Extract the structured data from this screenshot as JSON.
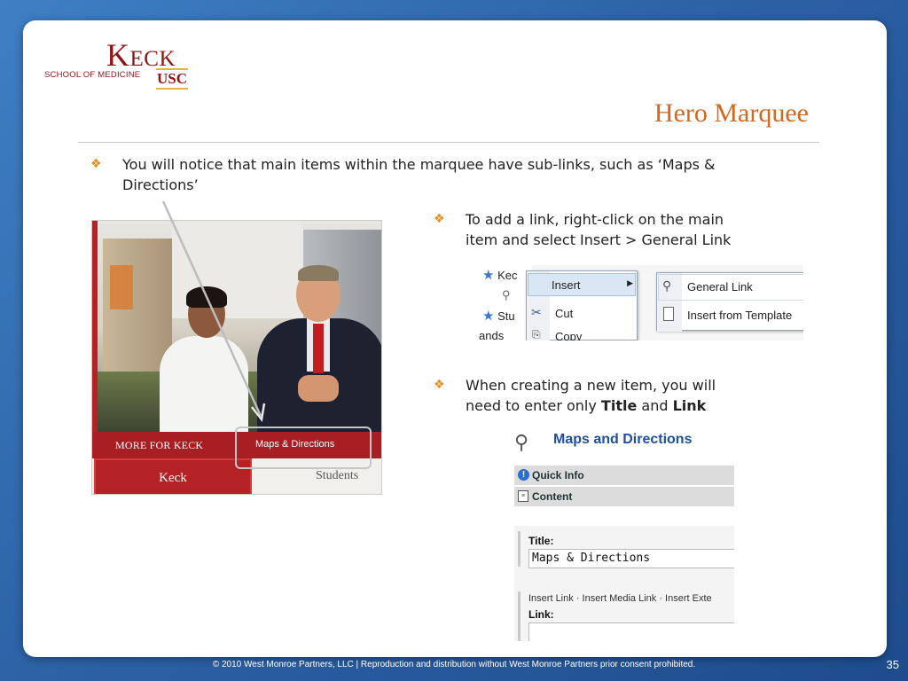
{
  "logo": {
    "keck": "Keck",
    "school": "SCHOOL OF MEDICINE",
    "usc": "USC"
  },
  "title": "Hero Marquee",
  "bullets": {
    "b1": "You will notice that main items within the marquee have sub-links, such as ‘Maps & Directions’",
    "b2": "To add a link, right-click on the main item and select Insert > General Link",
    "b3_pre": "When creating a new item, you will need to enter only ",
    "b3_title": "Title",
    "b3_mid": " and ",
    "b3_link": "Link"
  },
  "marquee": {
    "more": "MORE FOR KECK",
    "maps": "Maps & Directions",
    "keck_tab": "Keck",
    "students": "Students"
  },
  "context_menu": {
    "tree": [
      "Kec",
      "Stu",
      "ands"
    ],
    "menu1": [
      "Insert",
      "Cut",
      "Copy"
    ],
    "menu2": [
      "General Link",
      "Insert from Template"
    ]
  },
  "form": {
    "heading": "Maps and Directions",
    "quick_info": "Quick Info",
    "content": "Content",
    "title_label": "Title:",
    "title_value": "Maps & Directions",
    "links": "Insert Link  ·  Insert Media Link  ·  Insert Exte",
    "link_label": "Link:"
  },
  "footer": "© 2010 West Monroe Partners, LLC  |  Reproduction and distribution without West Monroe Partners prior consent prohibited.",
  "page_number": "35",
  "colors": {
    "title": "#d2691e",
    "bullet": "#e58a1e",
    "keck_red": "#8c1515",
    "background": "#2c62a6"
  }
}
